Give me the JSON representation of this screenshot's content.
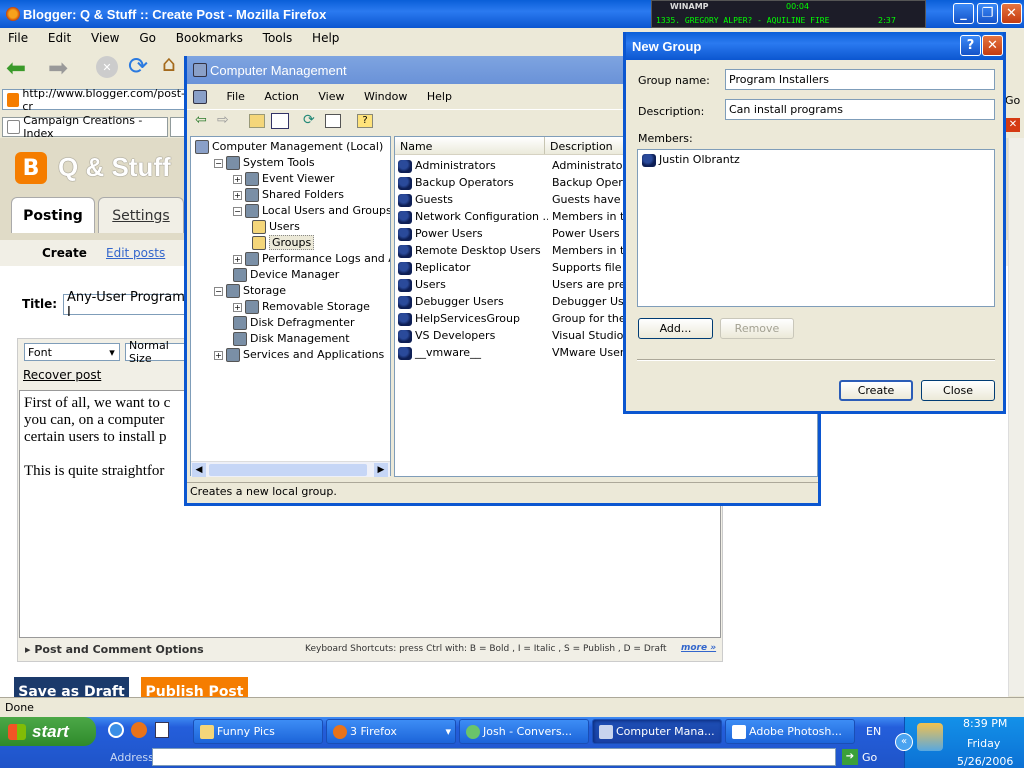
{
  "firefox": {
    "title": "Blogger: Q & Stuff :: Create Post - Mozilla Firefox",
    "menu": [
      "File",
      "Edit",
      "View",
      "Go",
      "Bookmarks",
      "Tools",
      "Help"
    ],
    "url": "http://www.blogger.com/post-cr",
    "tab": "Campaign Creations - Index",
    "go_label": "Go",
    "status": "Done"
  },
  "blogger": {
    "blog_title": "Q & Stuff",
    "tabs": [
      "Posting",
      "Settings"
    ],
    "subtabs": [
      "Create",
      "Edit posts"
    ],
    "title_label": "Title:",
    "title_value": "Any-User Program I",
    "font_select": "Font",
    "size_select": "Normal Size",
    "recover": "Recover post",
    "body_lines": [
      "First of all, we want to c",
      "you can, on a computer",
      "certain users to install p",
      "",
      "This is quite straightfor"
    ],
    "post_options": "Post and Comment Options",
    "shortcuts": "Keyboard Shortcuts: press Ctrl with: B = Bold , I = Italic , S = Publish , D = Draft",
    "more": "more »",
    "save_draft": "Save as Draft",
    "publish": "Publish Post"
  },
  "winamp": {
    "label": "WINAMP",
    "time": "00:04",
    "track": "1335. GREGORY ALPER? - AQUILINE FIRE",
    "length": "2:37"
  },
  "compmgmt": {
    "title": "Computer Management",
    "menu": [
      "File",
      "Action",
      "View",
      "Window",
      "Help"
    ],
    "tree": [
      {
        "label": "Computer Management (Local)",
        "level": 0
      },
      {
        "label": "System Tools",
        "level": 1
      },
      {
        "label": "Event Viewer",
        "level": 2
      },
      {
        "label": "Shared Folders",
        "level": 2
      },
      {
        "label": "Local Users and Groups",
        "level": 2
      },
      {
        "label": "Users",
        "level": 3
      },
      {
        "label": "Groups",
        "level": 3
      },
      {
        "label": "Performance Logs and Alerts",
        "level": 2
      },
      {
        "label": "Device Manager",
        "level": 2
      },
      {
        "label": "Storage",
        "level": 1
      },
      {
        "label": "Removable Storage",
        "level": 2
      },
      {
        "label": "Disk Defragmenter",
        "level": 2
      },
      {
        "label": "Disk Management",
        "level": 2
      },
      {
        "label": "Services and Applications",
        "level": 1
      }
    ],
    "columns": [
      "Name",
      "Description"
    ],
    "groups": [
      {
        "name": "Administrators",
        "desc": "Administrators h"
      },
      {
        "name": "Backup Operators",
        "desc": "Backup Operato"
      },
      {
        "name": "Guests",
        "desc": "Guests have the"
      },
      {
        "name": "Network Configuration ...",
        "desc": "Members in this"
      },
      {
        "name": "Power Users",
        "desc": "Power Users po"
      },
      {
        "name": "Remote Desktop Users",
        "desc": "Members in this"
      },
      {
        "name": "Replicator",
        "desc": "Supports file rep"
      },
      {
        "name": "Users",
        "desc": "Users are preve"
      },
      {
        "name": "Debugger Users",
        "desc": "Debugger Users"
      },
      {
        "name": "HelpServicesGroup",
        "desc": "Group for the H"
      },
      {
        "name": "VS Developers",
        "desc": "Visual Studio de"
      },
      {
        "name": "__vmware__",
        "desc": "VMware User Gr"
      }
    ],
    "status": "Creates a new local group."
  },
  "newgroup": {
    "title": "New Group",
    "group_name_label": "Group name:",
    "group_name": "Program Installers",
    "description_label": "Description:",
    "description": "Can install programs",
    "members_label": "Members:",
    "members": [
      "Justin Olbrantz"
    ],
    "add": "Add...",
    "remove": "Remove",
    "create": "Create",
    "close": "Close",
    "help": "?"
  },
  "taskbar": {
    "start": "start",
    "items": [
      "Funny Pics",
      "3 Firefox",
      "Josh - Convers...",
      "Computer Mana...",
      "Adobe Photosh..."
    ],
    "lang": "EN",
    "time": "8:39 PM",
    "day": "Friday",
    "date": "5/26/2006",
    "address_label": "Address",
    "go": "Go"
  }
}
